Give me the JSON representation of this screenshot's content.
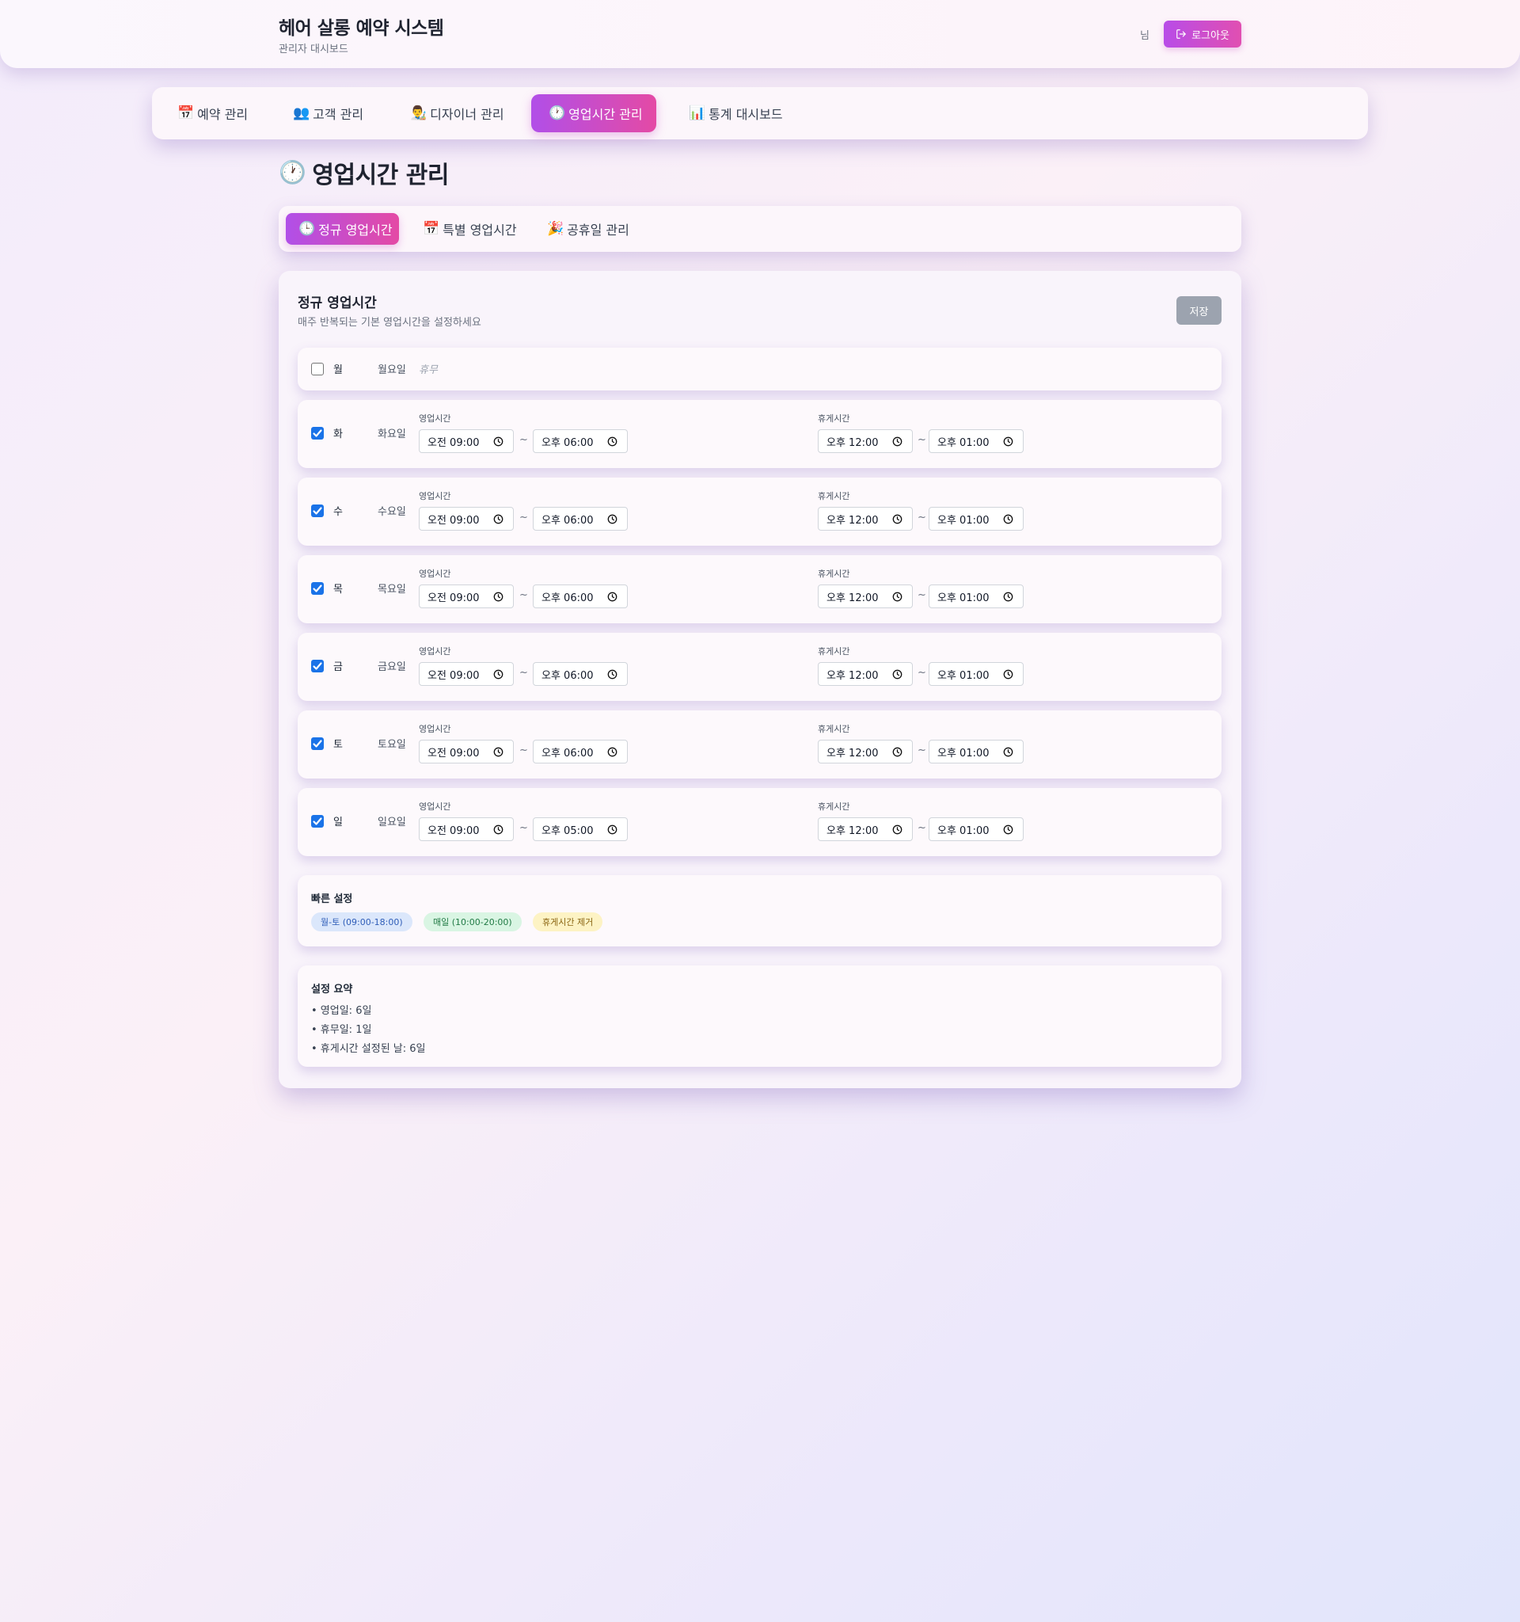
{
  "header": {
    "title": "헤어 살롱 예약 시스템",
    "subtitle": "관리자 대시보드",
    "user_suffix": "님",
    "logout_label": "로그아웃"
  },
  "nav": {
    "items": [
      {
        "emoji": "📅",
        "label": "예약 관리"
      },
      {
        "emoji": "👥",
        "label": "고객 관리"
      },
      {
        "emoji": "👨‍🎨",
        "label": "디자이너 관리"
      },
      {
        "emoji": "🕐",
        "label": "영업시간 관리"
      },
      {
        "emoji": "📊",
        "label": "통계 대시보드"
      }
    ],
    "active_index": 3
  },
  "page": {
    "title_emoji": "🕐",
    "title": "영업시간 관리"
  },
  "sub_tabs": {
    "items": [
      {
        "emoji": "🕒",
        "label": "정규 영업시간"
      },
      {
        "emoji": "📅",
        "label": "특별 영업시간"
      },
      {
        "emoji": "🎉",
        "label": "공휴일 관리"
      }
    ],
    "active_index": 0
  },
  "card": {
    "title": "정규 영업시간",
    "subtitle": "매주 반복되는 기본 영업시간을 설정하세요",
    "save_label": "저장",
    "hours_label": "영업시간",
    "break_label": "휴게시간",
    "separator": "~",
    "closed_label": "휴무"
  },
  "days": [
    {
      "short": "월",
      "full": "월요일",
      "enabled": false
    },
    {
      "short": "화",
      "full": "화요일",
      "enabled": true,
      "open": "오전 09:00",
      "close": "오후 06:00",
      "break_start": "오후 12:00",
      "break_end": "오후 01:00"
    },
    {
      "short": "수",
      "full": "수요일",
      "enabled": true,
      "open": "오전 09:00",
      "close": "오후 06:00",
      "break_start": "오후 12:00",
      "break_end": "오후 01:00"
    },
    {
      "short": "목",
      "full": "목요일",
      "enabled": true,
      "open": "오전 09:00",
      "close": "오후 06:00",
      "break_start": "오후 12:00",
      "break_end": "오후 01:00"
    },
    {
      "short": "금",
      "full": "금요일",
      "enabled": true,
      "open": "오전 09:00",
      "close": "오후 06:00",
      "break_start": "오후 12:00",
      "break_end": "오후 01:00"
    },
    {
      "short": "토",
      "full": "토요일",
      "enabled": true,
      "open": "오전 09:00",
      "close": "오후 06:00",
      "break_start": "오후 12:00",
      "break_end": "오후 01:00"
    },
    {
      "short": "일",
      "full": "일요일",
      "enabled": true,
      "open": "오전 09:00",
      "close": "오후 05:00",
      "break_start": "오후 12:00",
      "break_end": "오후 01:00"
    }
  ],
  "quick": {
    "title": "빠른 설정",
    "buttons": [
      {
        "label": "월-토 (09:00-18:00)",
        "bg": "#dbe7fb",
        "fg": "#2f5db8"
      },
      {
        "label": "매일 (10:00-20:00)",
        "bg": "#d9f5e3",
        "fg": "#217a45"
      },
      {
        "label": "휴게시간 제거",
        "bg": "#fdf3c4",
        "fg": "#8a6512"
      }
    ]
  },
  "summary": {
    "title": "설정 요약",
    "lines": [
      "• 영업일: 6일",
      "• 휴무일: 1일",
      "• 휴게시간 설정된 날: 6일"
    ]
  },
  "colors": {
    "accent_from": "#b14fe8",
    "accent_to": "#e44aa5",
    "checkbox": "#1a73e8",
    "save_disabled": "#9ca3af"
  }
}
